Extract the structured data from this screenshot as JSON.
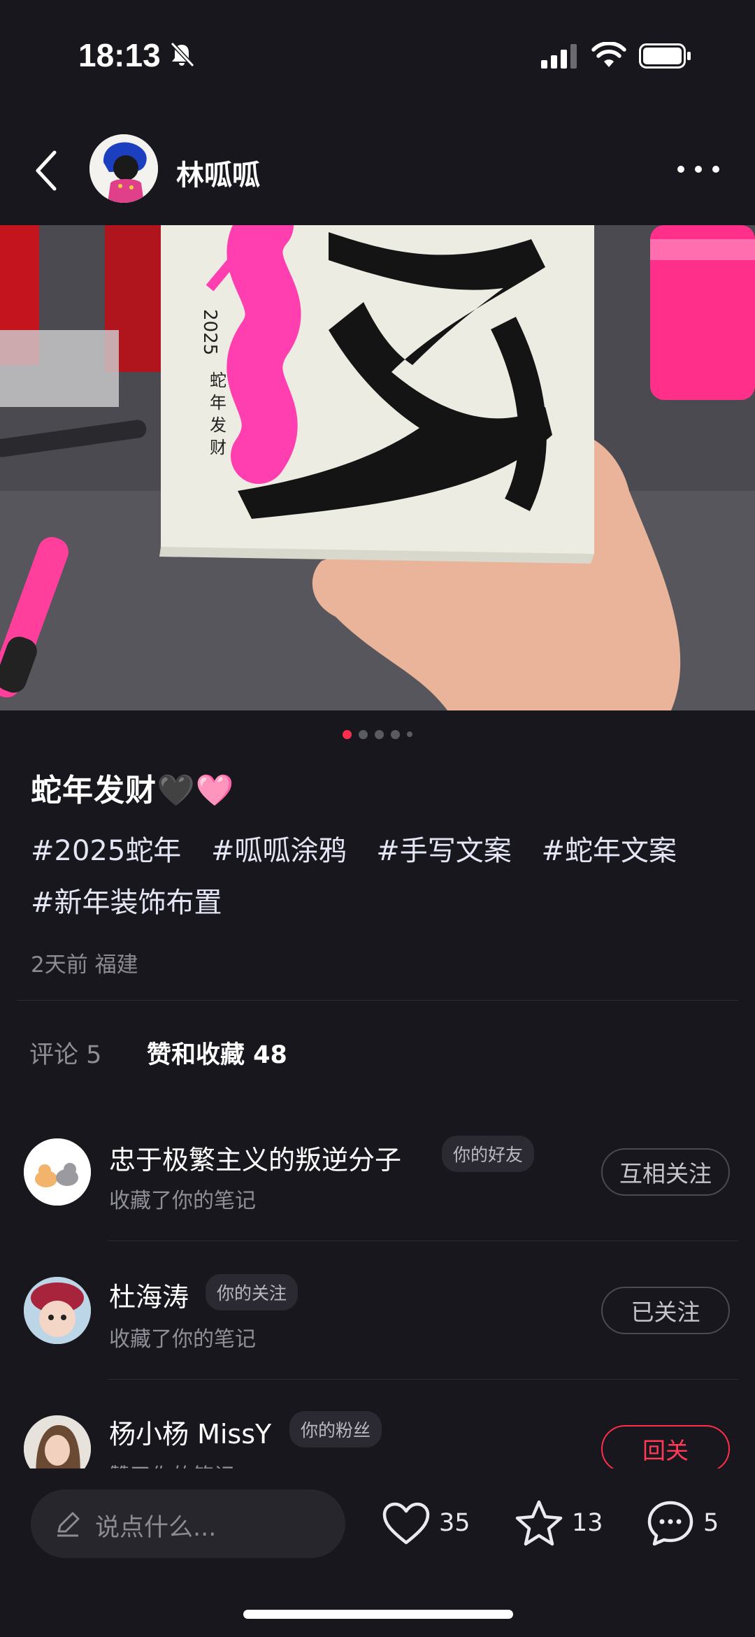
{
  "status_bar": {
    "time": "18:13"
  },
  "header": {
    "author_name": "林呱呱"
  },
  "note": {
    "title": "蛇年发财🖤🩷",
    "tags": [
      "#2025蛇年",
      "#呱呱涂鸦",
      "#手写文案",
      "#蛇年文案",
      "#新年装饰布置"
    ],
    "meta": "2天前 福建",
    "image_pages": 5,
    "current_image": 1
  },
  "tabs": {
    "comments": "评论 5",
    "likes": "赞和收藏 48"
  },
  "rows": [
    {
      "name": "忠于极繁主义的叛逆分子",
      "badge": "你的好友",
      "action": "收藏了你的笔记",
      "button": "互相关注"
    },
    {
      "name": "杜海涛",
      "badge": "你的关注",
      "action": "收藏了你的笔记",
      "button": "已关注"
    },
    {
      "name": "杨小杨 MissY",
      "badge": "你的粉丝",
      "action": "赞了你的笔记",
      "button": "回关"
    }
  ],
  "bottom_bar": {
    "placeholder": "说点什么...",
    "likes": "35",
    "stars": "13",
    "comments": "5"
  },
  "colors": {
    "accent": "#ff2e4d",
    "background": "#18171d",
    "tag": "#e3e6f4"
  }
}
